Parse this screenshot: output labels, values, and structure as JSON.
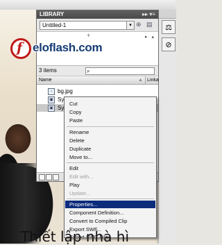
{
  "library": {
    "title": "LIBRARY",
    "document": "Untitled-1",
    "count": "3 items",
    "col_name": "Name",
    "col_link": "Linka",
    "items": [
      {
        "label": "bg.jpg",
        "icon": "bitmap-icon"
      },
      {
        "label": "Symbol 1",
        "icon": "movieclip-icon"
      },
      {
        "label": "Symbol 2",
        "icon": "movieclip-icon"
      }
    ]
  },
  "logo": {
    "text": "eloflash.com"
  },
  "menu": {
    "items": [
      {
        "label": "Cut"
      },
      {
        "label": "Copy"
      },
      {
        "label": "Paste"
      },
      {
        "label": "Rename"
      },
      {
        "label": "Delete"
      },
      {
        "label": "Duplicate"
      },
      {
        "label": "Move to..."
      },
      {
        "label": "Edit"
      },
      {
        "label": "Edit with..."
      },
      {
        "label": "Play"
      },
      {
        "label": "Update..."
      },
      {
        "label": "Properties..."
      },
      {
        "label": "Component Definition..."
      },
      {
        "label": "Convert to Compiled Clip"
      },
      {
        "label": "Export SWF..."
      },
      {
        "label": "Export SWC File..."
      }
    ]
  },
  "caption": "Thiết lập nhà hì",
  "colors": {
    "highlight": "#0c2c7c",
    "logo_red": "#c01818",
    "logo_blue": "#163c74"
  }
}
